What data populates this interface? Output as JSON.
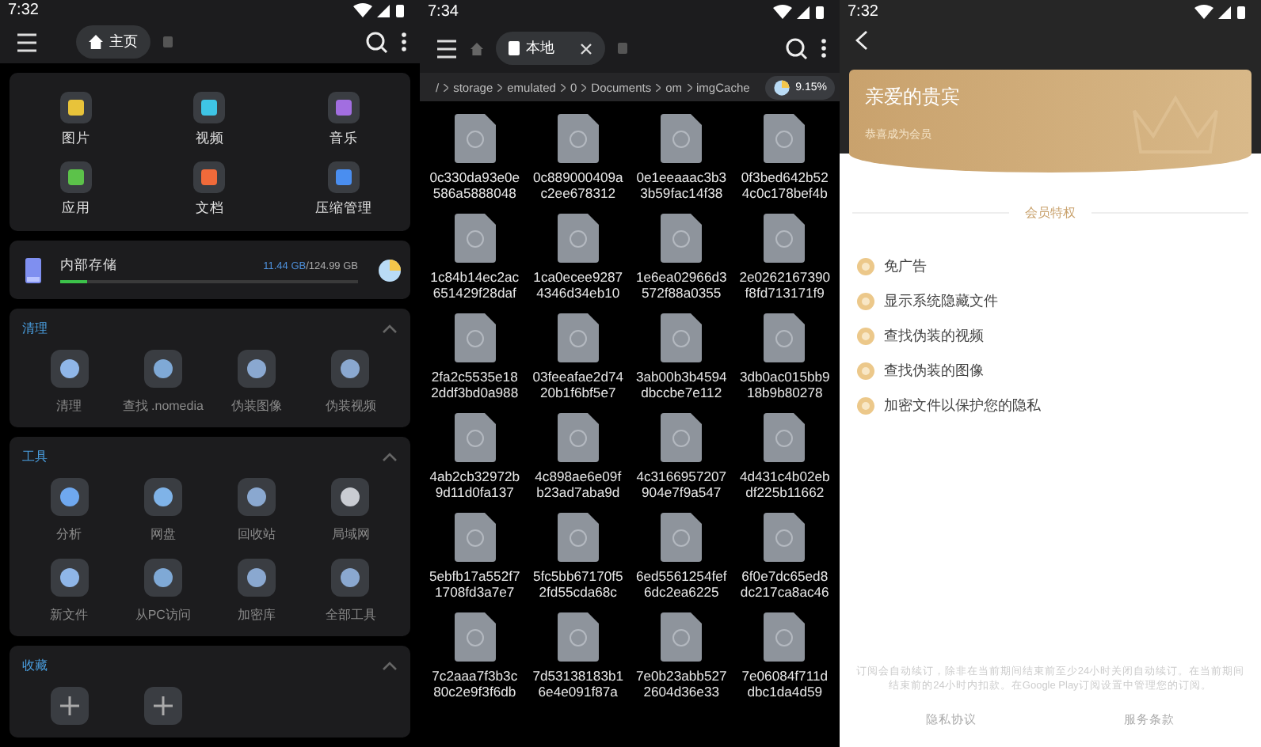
{
  "home": {
    "status": {
      "time": "7:32"
    },
    "tab": {
      "label": "主页",
      "selected": true
    },
    "categories": [
      {
        "label": "图片"
      },
      {
        "label": "视频"
      },
      {
        "label": "音乐"
      },
      {
        "label": "应用"
      },
      {
        "label": "文档"
      },
      {
        "label": "压缩管理"
      }
    ],
    "storage": {
      "label": "内部存储",
      "used": "11.44 GB",
      "total": "/124.99 GB",
      "level": 0.092
    },
    "sections": [
      {
        "title": "清理",
        "expanded": true,
        "items": [
          {
            "label": "清理"
          },
          {
            "label": "查找 .nomedia"
          },
          {
            "label": "伪装图像"
          },
          {
            "label": "伪装视频"
          }
        ]
      },
      {
        "title": "工具",
        "expanded": true,
        "items": [
          {
            "label": "分析"
          },
          {
            "label": "网盘"
          },
          {
            "label": "回收站"
          },
          {
            "label": "局域网"
          },
          {
            "label": "新文件"
          },
          {
            "label": "从PC访问"
          },
          {
            "label": "加密库"
          },
          {
            "label": "全部工具"
          }
        ]
      },
      {
        "title": "收藏",
        "expanded": true
      }
    ]
  },
  "browser": {
    "status": {
      "time": "7:34"
    },
    "tab": {
      "label": "本地",
      "selected": true
    },
    "breadcrumb": [
      "/",
      "storage",
      "emulated",
      "0",
      "Documents",
      "om",
      "imgCache"
    ],
    "usage": "9.15%",
    "files": [
      "0c330da93e0e586a5888048",
      "0c889000409ac2ee678312",
      "0e1eeaaac3b33b59fac14f38",
      "0f3bed642b524c0c178bef4b",
      "1c84b14ec2ac651429f28daf",
      "1ca0ecee92874346d34eb10",
      "1e6ea02966d3572f88a0355",
      "2e0262167390f8fd713171f9",
      "2fa2c5535e182ddf3bd0a988",
      "03feeafae2d7420b1f6bf5e7",
      "3ab00b3b4594dbccbe7e112",
      "3db0ac015bb918b9b80278",
      "4ab2cb32972b9d11d0fa137",
      "4c898ae6e09fb23ad7aba9d",
      "4c3166957207904e7f9a547",
      "4d431c4b02ebdf225b11662",
      "5ebfb17a552f71708fd3a7e7",
      "5fc5bb67170f52fd55cda68c",
      "6ed5561254fef6dc2ea6225",
      "6f0e7dc65ed8dc217ca8ac46",
      "7c2aaa7f3b3c80c2e9f3f6db",
      "7d53138183b16e4e091f87a",
      "7e0b23abb5272604d36e33",
      "7e06084f711ddbc1da4d59"
    ]
  },
  "vip": {
    "status": {
      "time": "7:32"
    },
    "title": "亲爱的贵宾",
    "subtitle": "恭喜成为会员",
    "heading": "会员特权",
    "features": [
      "免广告",
      "显示系统隐藏文件",
      "查找伪装的视频",
      "查找伪装的图像",
      "加密文件以保护您的隐私"
    ],
    "notice": "订阅会自动续订，除非在当前期间结束前至少24小时关闭自动续订。在当前期间结束前的24小时内扣款。在Google Play订阅设置中管理您的订阅。",
    "links": [
      "隐私协议",
      "服务条款"
    ]
  }
}
